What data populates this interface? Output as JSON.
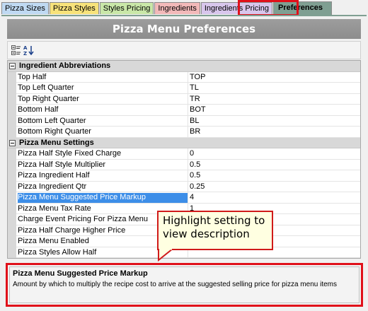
{
  "tabs": [
    {
      "label": "Pizza Sizes"
    },
    {
      "label": "Pizza Styles"
    },
    {
      "label": "Styles Pricing"
    },
    {
      "label": "Ingredients"
    },
    {
      "label": "Ingredients Pricing"
    },
    {
      "label": "Preferences",
      "active": true
    }
  ],
  "header": {
    "title": "Pizza Menu Preferences"
  },
  "toolbar": {
    "categorized_icon": "categorized-icon",
    "alphabetical_icon": "sort-alphabetical-icon"
  },
  "colors": {
    "active_tab": "#7f9f92",
    "selection": "#3d8ee8",
    "highlight_border": "#e0101a",
    "callout_bg": "#ffffe1"
  },
  "grid": {
    "categories": [
      {
        "name": "Ingredient Abbreviations",
        "expanded": true,
        "rows": [
          {
            "label": "Top Half",
            "value": "TOP"
          },
          {
            "label": "Top Left Quarter",
            "value": "TL"
          },
          {
            "label": "Top Right Quarter",
            "value": "TR"
          },
          {
            "label": "Bottom Half",
            "value": "BOT"
          },
          {
            "label": "Bottom Left Quarter",
            "value": "BL"
          },
          {
            "label": "Bottom Right Quarter",
            "value": "BR"
          }
        ]
      },
      {
        "name": "Pizza Menu Settings",
        "expanded": true,
        "rows": [
          {
            "label": "Pizza Half Style Fixed Charge",
            "value": "0"
          },
          {
            "label": "Pizza Half Style Multiplier",
            "value": "0.5"
          },
          {
            "label": "Pizza Ingredient Half",
            "value": "0.5"
          },
          {
            "label": "Pizza Ingredient Qtr",
            "value": "0.25"
          },
          {
            "label": "Pizza Menu Suggested Price Markup",
            "value": "4",
            "selected": true
          },
          {
            "label": "Pizza Menu Tax Rate",
            "value": "1"
          },
          {
            "label": "Charge Event Pricing For Pizza Menu",
            "value": ""
          },
          {
            "label": "Pizza Half Charge Higher Price",
            "value": ""
          },
          {
            "label": "Pizza Menu Enabled",
            "value": ""
          },
          {
            "label": "Pizza Styles Allow Half",
            "value": ""
          }
        ]
      }
    ]
  },
  "callout": {
    "text": "Highlight setting to view description"
  },
  "description": {
    "title": "Pizza Menu Suggested Price Markup",
    "text": "Amount by which to multiply the recipe cost to arrive at the suggested selling price for pizza menu items"
  }
}
